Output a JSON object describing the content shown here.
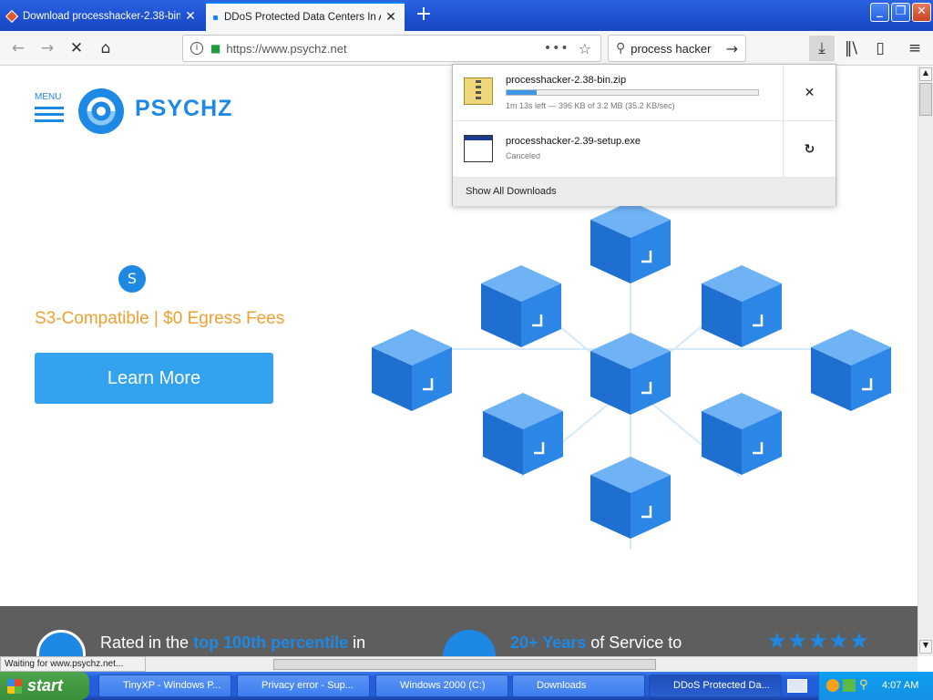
{
  "browser": {
    "tabs": [
      {
        "title": "Download processhacker-2.38-bin"
      },
      {
        "title": "DDoS Protected Data Centers In A"
      }
    ],
    "url": "https://www.psychz.net",
    "search_text": "process hacker"
  },
  "downloads": {
    "items": [
      {
        "name": "processhacker-2.38-bin.zip",
        "status": "1m 13s left — 396 KB of 3.2 MB (35.2 KB/sec)",
        "progress": 0.12,
        "action_icon": "cancel-icon"
      },
      {
        "name": "processhacker-2.39-setup.exe",
        "status": "Canceled",
        "action_icon": "retry-icon"
      }
    ],
    "show_all": "Show All Downloads"
  },
  "page": {
    "menu_label": "MENU",
    "brand": "PSYCHZ",
    "badge": "S",
    "tagline": "S3-Compatible | $0 Egress Fees",
    "cta": "Learn More",
    "band": {
      "left_prefix": "Rated in the ",
      "left_highlight": "top 100th percentile",
      "left_suffix": " in",
      "right_highlight": "20+ Years",
      "right_suffix": " of Service to"
    }
  },
  "status_text": "Waiting for www.psychz.net...",
  "taskbar": {
    "start": "start",
    "items": [
      {
        "label": "TinyXP - Windows P..."
      },
      {
        "label": "Privacy error - Sup..."
      },
      {
        "label": "Windows 2000 (C:)"
      },
      {
        "label": "Downloads"
      },
      {
        "label": "DDoS Protected Da..."
      }
    ],
    "clock": "4:07 AM"
  },
  "colors": {
    "accent": "#1e88e5",
    "tagline": "#f0a030",
    "cta": "#33a3f0"
  }
}
